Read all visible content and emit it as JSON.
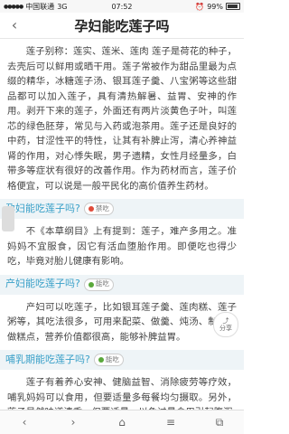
{
  "status_bar": {
    "carrier": "中国联通",
    "network": "3G",
    "time": "07:52",
    "battery_percent": "99%"
  },
  "header": {
    "title": "孕妇能吃莲子吗",
    "back_label": "‹"
  },
  "intro": {
    "text": "莲子别称：莲实、莲米、莲肉 莲子是荷花的种子，去壳后可以鲜用或晒干用。莲子常被作为甜品里最为点缀的精华，冰糖莲子汤、银耳莲子羹、八宝粥等这些甜品都可以加入莲子，具有清热解暑、益胃、安神的作用。剥开下来的莲子，外面还有两片淡黄色子叶，叫莲芯的绿色胚芽，常见与入药或泡茶用。莲子还是良好的中药，甘涩性平的特性，让其有补脾止泻，清心养神益肾的作用，对心悸失眠，男子遗精，女性月经量多，白带多等症状有很好的改善作用。作为药材而言，莲子价格便宜，可以说是一般平民化的高价值养生药材。"
  },
  "sections": [
    {
      "question": "孕妇能吃莲子吗?",
      "badge": "禁吃",
      "badge_type": "forbid",
      "text": "不《本草纲目》上有提到：莲子，难产多用之。准妈妈不宜服食，因它有活血堕胎作用。即便吃也得少吃，毕竟对胎儿健康有影响。"
    },
    {
      "question": "产妇能吃莲子吗?",
      "badge": "能吃",
      "badge_type": "ok",
      "text": "产妇可以吃莲子，比如银耳莲子羹、莲肉糕、莲子粥等，其吃法很多，可用来配菜、做羹、炖汤、制饯、做糕点，营养价值都很高，能够补脾益胃。"
    },
    {
      "question": "哺乳期能吃莲子吗?",
      "badge": "能吃",
      "badge_type": "ok",
      "text": "莲子有着养心安神、健脑益智、消除疲劳等疗效，哺乳妈妈可以食用，但要适量多每餐均匀摄取。另外，莲子虽然味道清香，但要适量，以免过量食用引起腹泻"
    }
  ],
  "share_button": {
    "label": "分享"
  },
  "toolbar": {
    "back": "‹",
    "forward": "›",
    "home": "⌂",
    "menu": "≡",
    "tabs": "⧉"
  }
}
